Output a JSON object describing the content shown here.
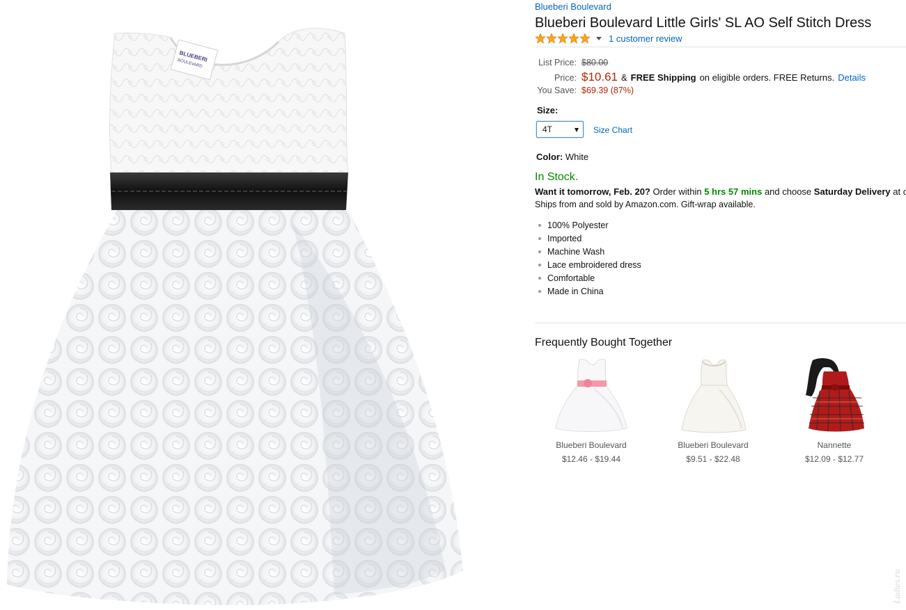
{
  "brand": "Blueberi Boulevard",
  "title": "Blueberi Boulevard Little Girls' SL AO Self Stitch Dress",
  "rating": {
    "stars": 5,
    "review_link": "1 customer review"
  },
  "pricing": {
    "list_label": "List Price:",
    "list_price": "$80.00",
    "price_label": "Price:",
    "price": "$10.61",
    "amp": "&",
    "free_shipping": "FREE Shipping",
    "eligible": "on eligible orders. FREE Returns.",
    "details": "Details",
    "save_label": "You Save:",
    "save_value": "$69.39 (87%)"
  },
  "size": {
    "label": "Size:",
    "selected": "4T",
    "chart_link": "Size Chart"
  },
  "color": {
    "label": "Color:",
    "value": "White"
  },
  "availability": {
    "in_stock": "In Stock.",
    "want_it": "Want it tomorrow, Feb. 20?",
    "order_within": "Order within",
    "countdown": "5 hrs 57 mins",
    "and_choose": "and choose",
    "saturday": "Saturday Delivery",
    "at": "at c",
    "ships": "Ships from and sold by Amazon.com. Gift-wrap available."
  },
  "features": [
    "100% Polyester",
    "Imported",
    "Machine Wash",
    "Lace embroidered dress",
    "Comfortable",
    "Made in China"
  ],
  "fbt": {
    "title": "Frequently Bought Together",
    "items": [
      {
        "name": "Blueberi Boulevard",
        "price": "$12.46 - $19.44"
      },
      {
        "name": "Blueberi Boulevard",
        "price": "$9.51 - $22.48"
      },
      {
        "name": "Nannette",
        "price": "$12.09 - $12.77"
      }
    ]
  },
  "tag": {
    "line1": "BLUEBERI",
    "line2": "BOULEVARD"
  },
  "watermark": "Ladies.ru",
  "colors": {
    "link": "#0066c0",
    "price": "#b12704",
    "stock": "#008a00",
    "star": "#ffa41c",
    "sash": "#1c1c1c"
  }
}
